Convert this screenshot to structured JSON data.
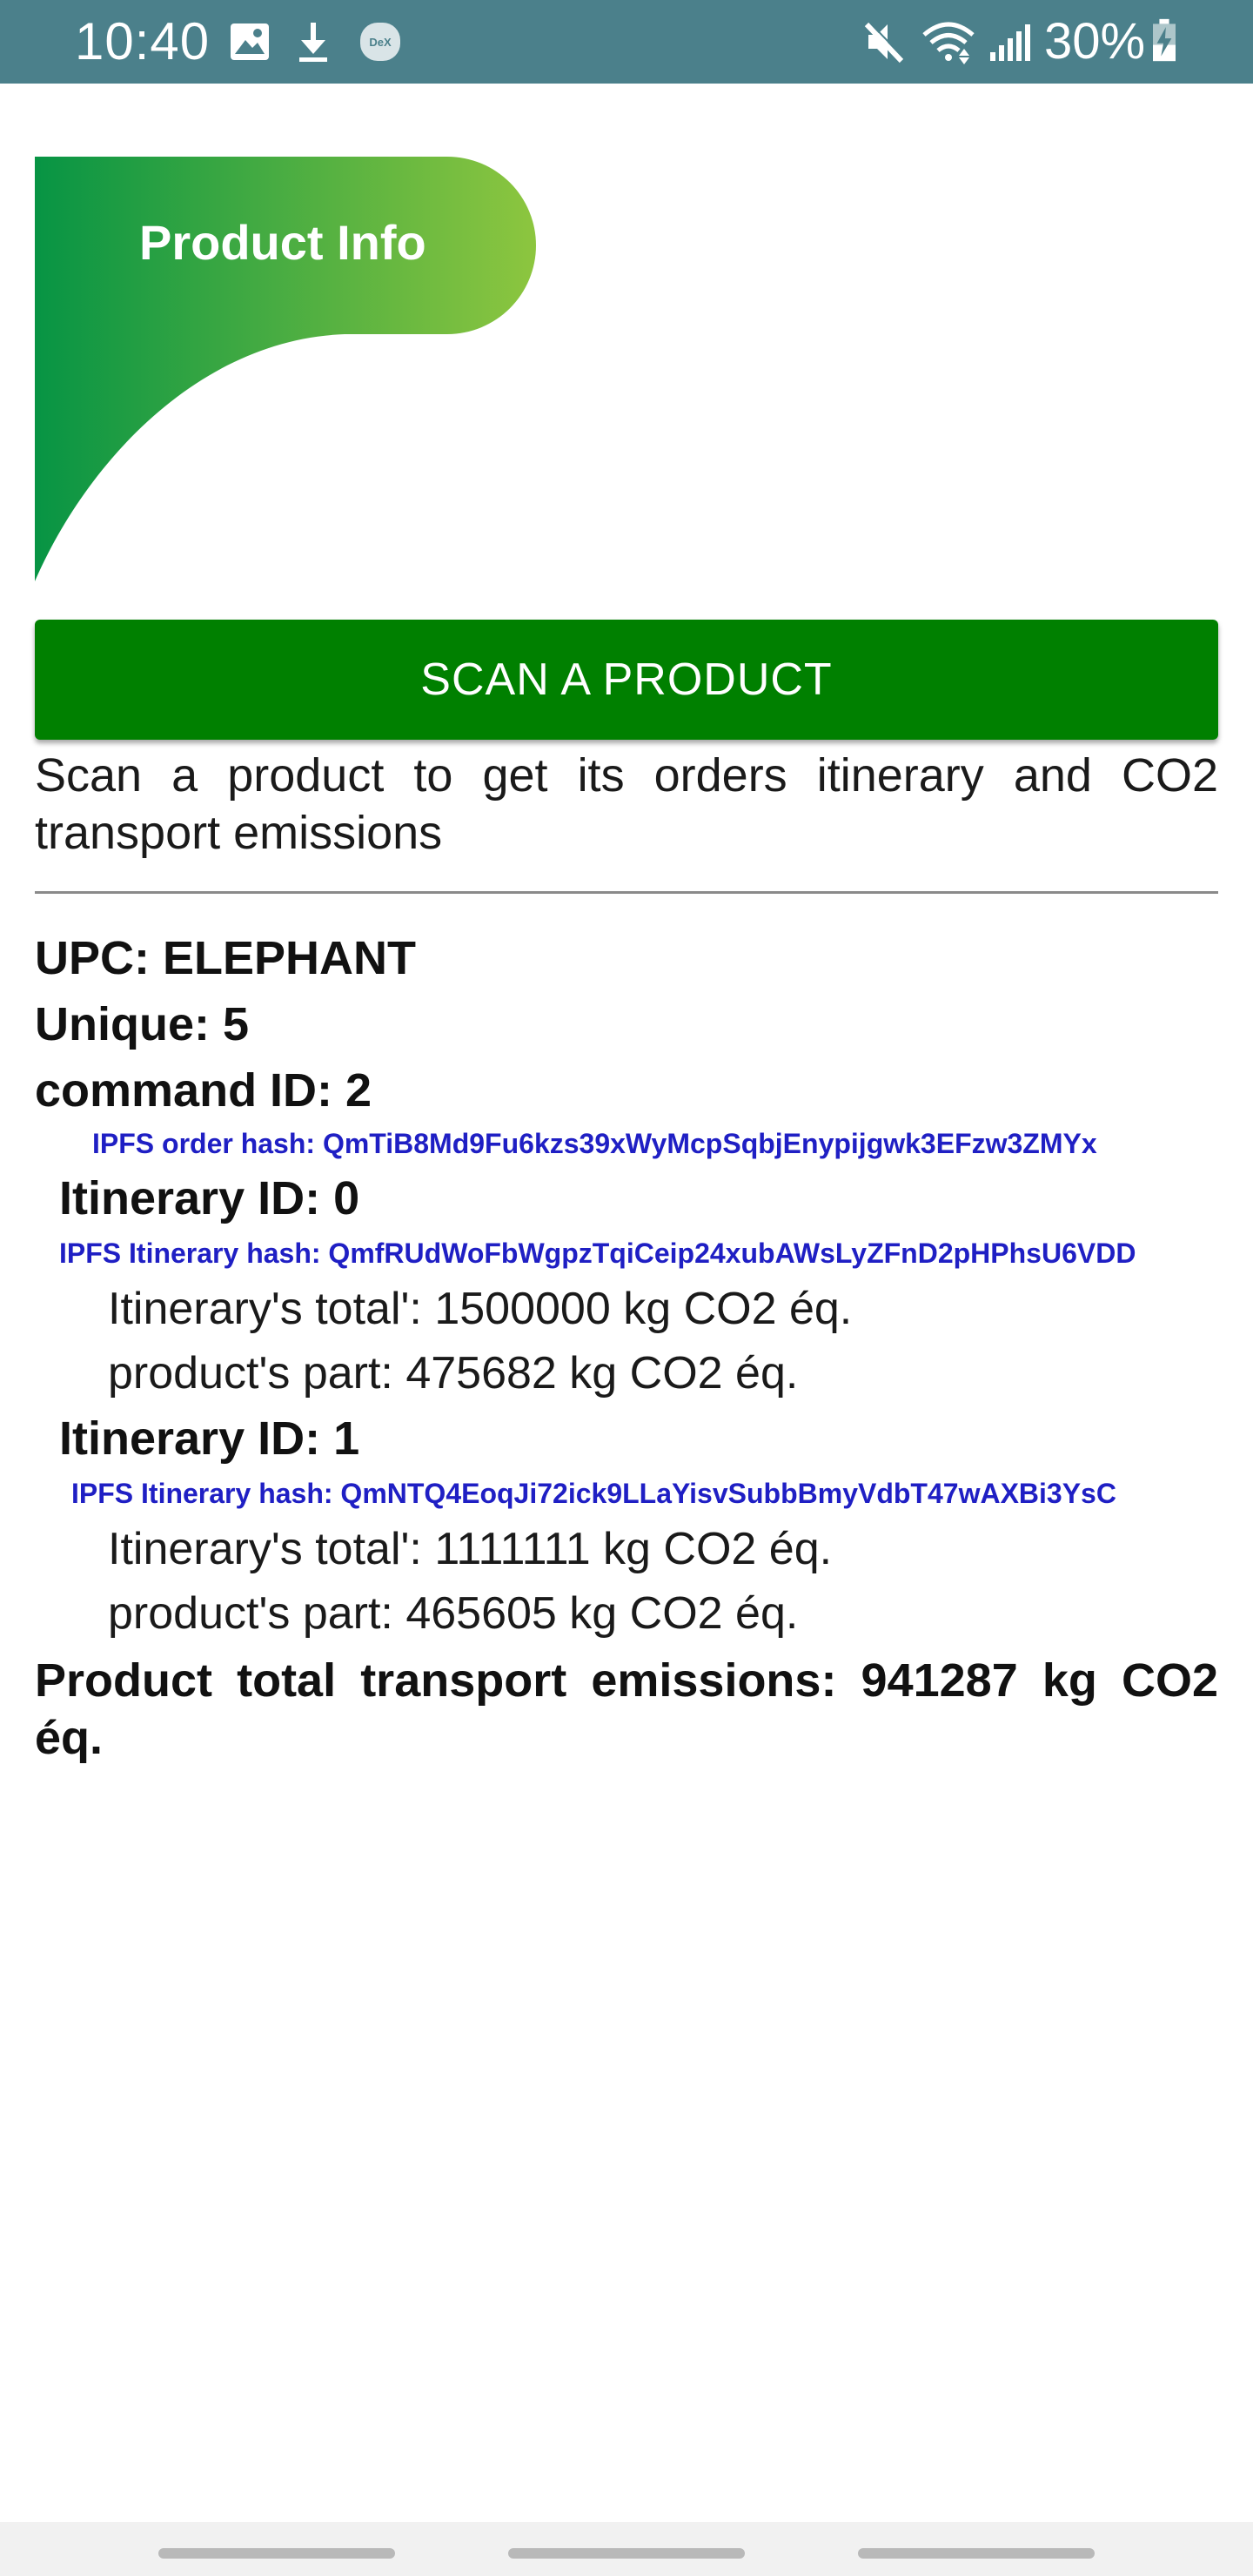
{
  "status_bar": {
    "time": "10:40",
    "battery": "30%",
    "icons": [
      "image-icon",
      "download-icon",
      "dex-icon",
      "mute-icon",
      "wifi-icon",
      "signal-icon",
      "battery-charging-icon"
    ],
    "dex_label": "DeX",
    "background": "#4b808b"
  },
  "header": {
    "title": "Product Info",
    "gradient_start": "#079444",
    "gradient_end": "#8dc63f"
  },
  "scan_button": {
    "label": "SCAN A PRODUCT",
    "color": "#008000"
  },
  "description": "Scan a product to get its orders itinerary and CO2 transport emissions",
  "product": {
    "upc": "UPC: ELEPHANT",
    "unique": "Unique: 5",
    "command_id": "command ID: 2",
    "ipfs_order_hash": "IPFS order hash: QmTiB8Md9Fu6kzs39xWyMcpSqbjEnypijgwk3EFzw3ZMYx",
    "itineraries": [
      {
        "id": "Itinerary ID: 0",
        "ipfs_hash": "IPFS Itinerary hash: QmfRUdWoFbWgpzTqiCeip24xubAWsLyZFnD2pHPhsU6VDD",
        "total": "Itinerary's total': 1500000 kg CO2 éq.",
        "part": "product's part: 475682 kg CO2 éq."
      },
      {
        "id": "Itinerary ID: 1",
        "ipfs_hash": "IPFS Itinerary hash: QmNTQ4EoqJi72ick9LLaYisvSubbBmyVdbT47wAXBi3YsC",
        "total": "Itinerary's total': 1111111 kg CO2 éq.",
        "part": "product's part: 465605 kg CO2 éq."
      }
    ],
    "total_emissions": "Product total transport emissions: 941287  kg CO2 éq."
  },
  "colors": {
    "hash_text": "#1f1fc4",
    "divider": "#8a8a8a"
  }
}
